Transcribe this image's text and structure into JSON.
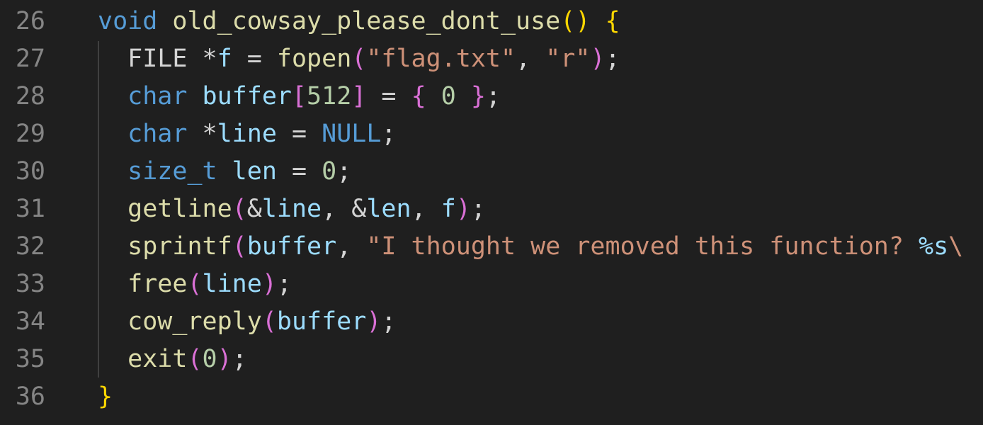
{
  "editor": {
    "colors": {
      "background": "#1f1f1f",
      "line_number": "#858585",
      "indent_guide": "#404040",
      "keyword": "#569cd6",
      "function": "#dcdcaa",
      "variable": "#9cdcfe",
      "string": "#ce9178",
      "number": "#b5cea8",
      "default": "#d4d4d4",
      "bracket_level_1": "#ffd700",
      "bracket_level_2": "#da70d6",
      "bracket_level_3": "#179fff"
    },
    "lines": [
      {
        "number": "26",
        "tokens": [
          {
            "text": "void",
            "kind": "kw"
          },
          {
            "text": " ",
            "kind": "def"
          },
          {
            "text": "old_cowsay_please_dont_use",
            "kind": "fn"
          },
          {
            "text": "()",
            "kind": "b1"
          },
          {
            "text": " ",
            "kind": "def"
          },
          {
            "text": "{",
            "kind": "b1"
          }
        ]
      },
      {
        "number": "27",
        "tokens": [
          {
            "text": "  ",
            "kind": "def"
          },
          {
            "text": "FILE",
            "kind": "def"
          },
          {
            "text": " ",
            "kind": "def"
          },
          {
            "text": "*",
            "kind": "def"
          },
          {
            "text": "f",
            "kind": "var"
          },
          {
            "text": " = ",
            "kind": "def"
          },
          {
            "text": "fopen",
            "kind": "fn"
          },
          {
            "text": "(",
            "kind": "b2"
          },
          {
            "text": "\"flag.txt\"",
            "kind": "str"
          },
          {
            "text": ", ",
            "kind": "def"
          },
          {
            "text": "\"r\"",
            "kind": "str"
          },
          {
            "text": ")",
            "kind": "b2"
          },
          {
            "text": ";",
            "kind": "def"
          }
        ]
      },
      {
        "number": "28",
        "tokens": [
          {
            "text": "  ",
            "kind": "def"
          },
          {
            "text": "char",
            "kind": "kw"
          },
          {
            "text": " ",
            "kind": "def"
          },
          {
            "text": "buffer",
            "kind": "var"
          },
          {
            "text": "[",
            "kind": "b2"
          },
          {
            "text": "512",
            "kind": "num"
          },
          {
            "text": "]",
            "kind": "b2"
          },
          {
            "text": " = ",
            "kind": "def"
          },
          {
            "text": "{",
            "kind": "b2"
          },
          {
            "text": " ",
            "kind": "def"
          },
          {
            "text": "0",
            "kind": "num"
          },
          {
            "text": " ",
            "kind": "def"
          },
          {
            "text": "}",
            "kind": "b2"
          },
          {
            "text": ";",
            "kind": "def"
          }
        ]
      },
      {
        "number": "29",
        "tokens": [
          {
            "text": "  ",
            "kind": "def"
          },
          {
            "text": "char",
            "kind": "kw"
          },
          {
            "text": " ",
            "kind": "def"
          },
          {
            "text": "*",
            "kind": "def"
          },
          {
            "text": "line",
            "kind": "var"
          },
          {
            "text": " = ",
            "kind": "def"
          },
          {
            "text": "NULL",
            "kind": "kw"
          },
          {
            "text": ";",
            "kind": "def"
          }
        ]
      },
      {
        "number": "30",
        "tokens": [
          {
            "text": "  ",
            "kind": "def"
          },
          {
            "text": "size_t",
            "kind": "kw"
          },
          {
            "text": " ",
            "kind": "def"
          },
          {
            "text": "len",
            "kind": "var"
          },
          {
            "text": " = ",
            "kind": "def"
          },
          {
            "text": "0",
            "kind": "num"
          },
          {
            "text": ";",
            "kind": "def"
          }
        ]
      },
      {
        "number": "31",
        "tokens": [
          {
            "text": "  ",
            "kind": "def"
          },
          {
            "text": "getline",
            "kind": "fn"
          },
          {
            "text": "(",
            "kind": "b2"
          },
          {
            "text": "&",
            "kind": "def"
          },
          {
            "text": "line",
            "kind": "var"
          },
          {
            "text": ", ",
            "kind": "def"
          },
          {
            "text": "&",
            "kind": "def"
          },
          {
            "text": "len",
            "kind": "var"
          },
          {
            "text": ", ",
            "kind": "def"
          },
          {
            "text": "f",
            "kind": "var"
          },
          {
            "text": ")",
            "kind": "b2"
          },
          {
            "text": ";",
            "kind": "def"
          }
        ]
      },
      {
        "number": "32",
        "tokens": [
          {
            "text": "  ",
            "kind": "def"
          },
          {
            "text": "sprintf",
            "kind": "fn"
          },
          {
            "text": "(",
            "kind": "b2"
          },
          {
            "text": "buffer",
            "kind": "var"
          },
          {
            "text": ", ",
            "kind": "def"
          },
          {
            "text": "\"I thought we removed this function? ",
            "kind": "str"
          },
          {
            "text": "%s",
            "kind": "var"
          },
          {
            "text": "\\",
            "kind": "str"
          }
        ]
      },
      {
        "number": "33",
        "tokens": [
          {
            "text": "  ",
            "kind": "def"
          },
          {
            "text": "free",
            "kind": "fn"
          },
          {
            "text": "(",
            "kind": "b2"
          },
          {
            "text": "line",
            "kind": "var"
          },
          {
            "text": ")",
            "kind": "b2"
          },
          {
            "text": ";",
            "kind": "def"
          }
        ]
      },
      {
        "number": "34",
        "tokens": [
          {
            "text": "  ",
            "kind": "def"
          },
          {
            "text": "cow_reply",
            "kind": "fn"
          },
          {
            "text": "(",
            "kind": "b2"
          },
          {
            "text": "buffer",
            "kind": "var"
          },
          {
            "text": ")",
            "kind": "b2"
          },
          {
            "text": ";",
            "kind": "def"
          }
        ]
      },
      {
        "number": "35",
        "tokens": [
          {
            "text": "  ",
            "kind": "def"
          },
          {
            "text": "exit",
            "kind": "fn"
          },
          {
            "text": "(",
            "kind": "b2"
          },
          {
            "text": "0",
            "kind": "num"
          },
          {
            "text": ")",
            "kind": "b2"
          },
          {
            "text": ";",
            "kind": "def"
          }
        ]
      },
      {
        "number": "36",
        "tokens": [
          {
            "text": "}",
            "kind": "b1"
          }
        ]
      }
    ]
  }
}
